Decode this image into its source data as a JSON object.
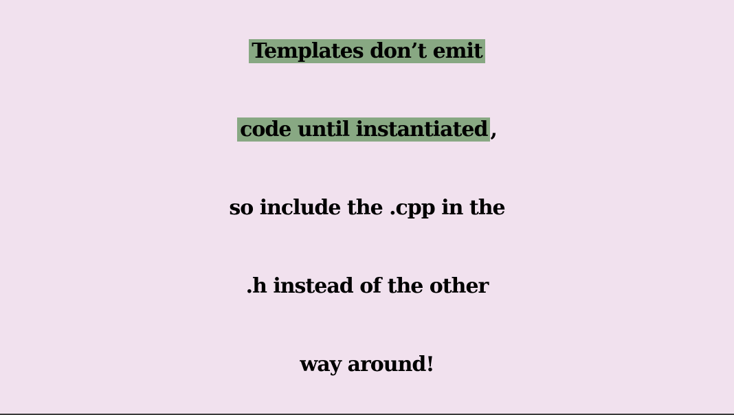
{
  "slide": {
    "lines": [
      {
        "highlight": "Templates don’t emit",
        "text": ""
      },
      {
        "highlight": "code until instantiated",
        "text": ","
      },
      {
        "highlight": "",
        "text": "so include the .cpp in the"
      },
      {
        "highlight": "",
        "text": ".h instead of the other"
      },
      {
        "highlight": "",
        "text": "way around!"
      }
    ]
  },
  "colors": {
    "background": "#f1e1ee",
    "highlight": "#88a883",
    "text": "#000000"
  }
}
